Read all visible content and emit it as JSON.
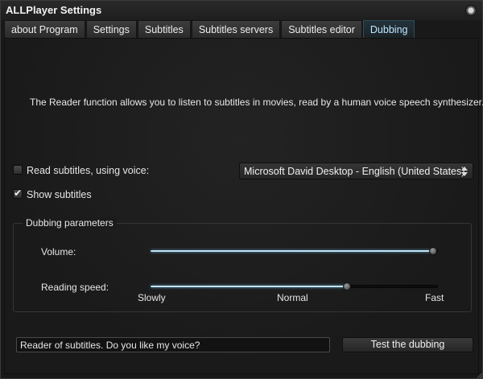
{
  "window": {
    "title": "ALLPlayer Settings",
    "close_icon": "close-icon"
  },
  "tabs": [
    {
      "label": "about Program",
      "active": false
    },
    {
      "label": "Settings",
      "active": false
    },
    {
      "label": "Subtitles",
      "active": false
    },
    {
      "label": "Subtitles servers",
      "active": false
    },
    {
      "label": "Subtitles editor",
      "active": false
    },
    {
      "label": "Dubbing",
      "active": true
    }
  ],
  "dubbing": {
    "description": "The Reader function allows you to listen to subtitles in movies, read by a human voice speech synthesizer.",
    "read_subtitles": {
      "label": "Read subtitles, using voice:",
      "checked": false
    },
    "show_subtitles": {
      "label": "Show subtitles",
      "checked": true
    },
    "voice_select": {
      "value": "Microsoft David Desktop - English (United States)"
    },
    "parameters": {
      "title": "Dubbing parameters",
      "volume": {
        "label": "Volume:",
        "value_fraction": 1.0
      },
      "reading_speed": {
        "label": "Reading speed:",
        "value_fraction": 0.69,
        "ticks": [
          "Slowly",
          "Normal",
          "Fast"
        ]
      }
    },
    "test_input": {
      "value": "Reader of subtitles. Do you like my voice?"
    },
    "test_button": {
      "label": "Test the dubbing"
    }
  },
  "colors": {
    "accent": "#9fd2ee",
    "active_tab_text": "#bfe6ff",
    "background": "#1b1b1b"
  }
}
